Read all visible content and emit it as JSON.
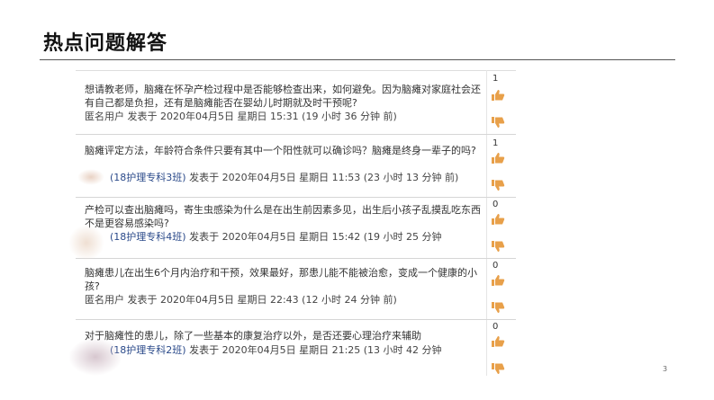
{
  "slide": {
    "title": "热点问题解答",
    "page_number": "3"
  },
  "posts": [
    {
      "body": "想请教老师，脑瘫在怀孕产检过程中是否能够检查出来，如何避免。因为脑瘫对家庭社会还有自己都是负担，还有是脑瘫能否在婴幼儿时期就及时干预呢?",
      "author": "匿名用户",
      "meta": "发表于 2020年04月5日 星期日 15:31 (19 小时 36 分钟 前)",
      "votes": "1"
    },
    {
      "body": "脑瘫评定方法，年龄符合条件只要有其中一个阳性就可以确诊吗？脑瘫是终身一辈子的吗?",
      "author": "(18护理专科3班)",
      "meta": "发表于 2020年04月5日 星期日 11:53 (23 小时 13 分钟 前)",
      "votes": "1"
    },
    {
      "body": "产检可以查出脑瘫吗，寄生虫感染为什么是在出生前因素多见，出生后小孩子乱摸乱吃东西不是更容易感染吗?",
      "author": "(18护理专科4班)",
      "meta": "发表于 2020年04月5日 星期日 15:42 (19 小时 25 分钟",
      "votes": "0"
    },
    {
      "body": "脑瘫患儿在出生6个月内治疗和干预，效果最好，那患儿能不能被治愈，变成一个健康的小孩?",
      "author": "匿名用户",
      "meta": "发表于 2020年04月5日 星期日 22:43 (12 小时 24 分钟 前)",
      "votes": "0"
    },
    {
      "body": "对于脑瘫性的患儿，除了一些基本的康复治疗以外，是否还要心理治疗来辅助",
      "author": "(18护理专科2班)",
      "meta": "发表于 2020年04月5日 星期日 21:25 (13 小时 42 分钟",
      "votes": "0"
    }
  ],
  "colors": {
    "thumb": "#e8a04a",
    "class_link": "#2b4a8a"
  },
  "icons": {
    "upvote": "thumbs-up-icon",
    "downvote": "thumbs-down-icon"
  }
}
